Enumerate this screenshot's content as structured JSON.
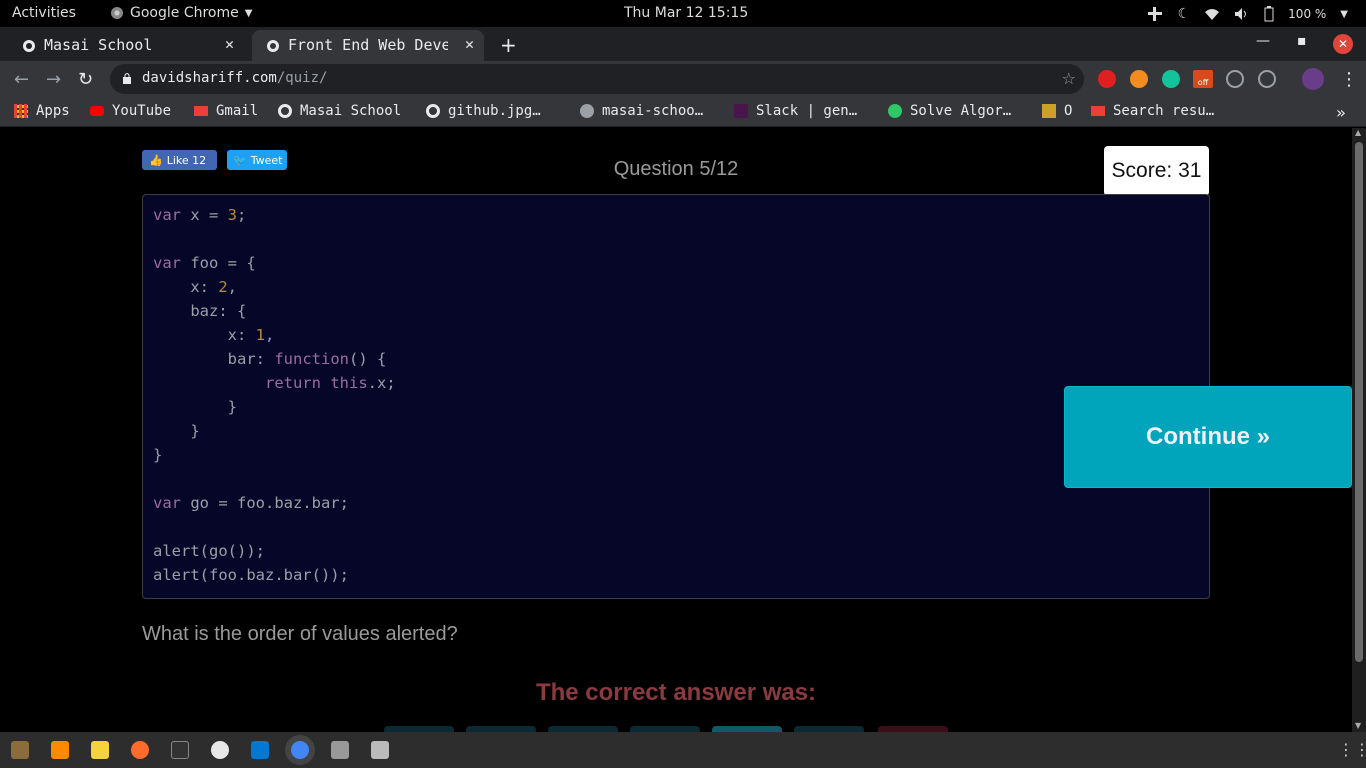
{
  "topbar": {
    "activities": "Activities",
    "app_name": "Google Chrome",
    "clock": "Thu Mar 12  15:15",
    "battery": "100 %"
  },
  "tabs": [
    {
      "title": "Masai School",
      "active": false
    },
    {
      "title": "Front End Web Developer Quiz",
      "active": true
    }
  ],
  "omnibox": {
    "host": "davidshariff.com",
    "path": "/quiz/"
  },
  "extensions": {
    "off_badge": "off"
  },
  "bookmarks": [
    {
      "label": "Apps",
      "icon": "apps-grid-icon"
    },
    {
      "label": "YouTube",
      "icon": "youtube-icon"
    },
    {
      "label": "Gmail",
      "icon": "gmail-icon"
    },
    {
      "label": "Masai School",
      "icon": "globe-icon"
    },
    {
      "label": "github.jpg…",
      "icon": "globe-icon"
    },
    {
      "label": "masai-schoo…",
      "icon": "github-icon"
    },
    {
      "label": "Slack | gen…",
      "icon": "slack-icon"
    },
    {
      "label": "Solve Algor…",
      "icon": "hackerrank-icon"
    },
    {
      "label": "O",
      "icon": "bookmark-icon"
    },
    {
      "label": "Search resu…",
      "icon": "gmail-icon"
    }
  ],
  "quiz": {
    "fb_like": "Like 12",
    "tweet": "Tweet",
    "question_number": "Question 5/12",
    "score": "Score: 31",
    "code_lines": [
      "var x = 3;",
      "",
      "var foo = {",
      "    x: 2,",
      "    baz: {",
      "        x: 1,",
      "        bar: function() {",
      "            return this.x;",
      "        }",
      "    }",
      "}",
      "",
      "var go = foo.baz.bar;",
      "",
      "alert(go());",
      "alert(foo.baz.bar());"
    ],
    "continue_label": "Continue »",
    "question_text": "What is the order of values alerted?",
    "correct_answer_label": "The correct answer was:"
  },
  "colors": {
    "continue_bg": "#00a5bb",
    "code_bg": "#060629",
    "answer_label": "#8b3a3f",
    "keyword": "#9b6e9a",
    "number": "#b9893c"
  }
}
